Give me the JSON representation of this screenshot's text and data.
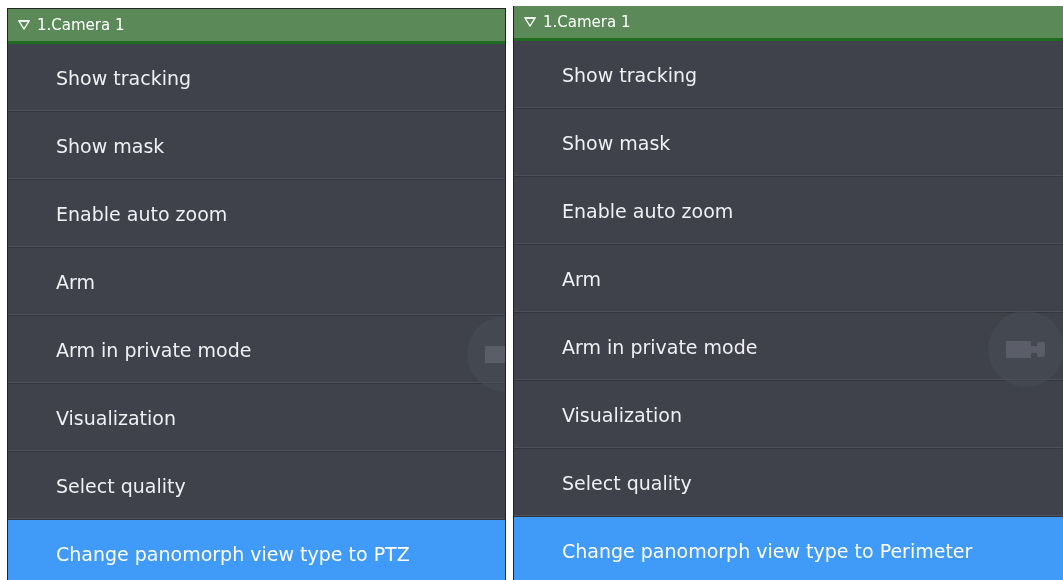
{
  "panels": [
    {
      "header": {
        "title": "1.Camera 1"
      },
      "items": [
        {
          "label": "Show tracking",
          "selected": false
        },
        {
          "label": "Show mask",
          "selected": false
        },
        {
          "label": "Enable auto zoom",
          "selected": false
        },
        {
          "label": "Arm",
          "selected": false
        },
        {
          "label": "Arm in private mode",
          "selected": false
        },
        {
          "label": "Visualization",
          "selected": false
        },
        {
          "label": "Select quality",
          "selected": false
        },
        {
          "label": "Change panomorph view type to PTZ",
          "selected": true
        }
      ]
    },
    {
      "header": {
        "title": "1.Camera 1"
      },
      "items": [
        {
          "label": "Show tracking",
          "selected": false
        },
        {
          "label": "Show mask",
          "selected": false
        },
        {
          "label": "Enable auto zoom",
          "selected": false
        },
        {
          "label": "Arm",
          "selected": false
        },
        {
          "label": "Arm in private mode",
          "selected": false
        },
        {
          "label": "Visualization",
          "selected": false
        },
        {
          "label": "Select quality",
          "selected": false
        },
        {
          "label": "Change panomorph view type to Perimeter",
          "selected": true
        }
      ]
    }
  ]
}
